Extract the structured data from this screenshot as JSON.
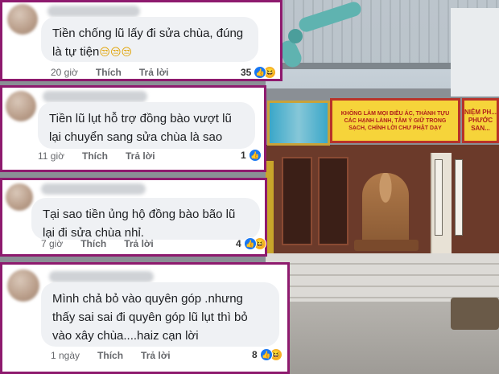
{
  "comments": [
    {
      "text": "Tiền chống lũ lấy đi sửa chùa, đúng là tự tiện",
      "emoji": "😒😒😒",
      "time": "20 giờ",
      "like": "Thích",
      "reply": "Trả lời",
      "reactions": "35"
    },
    {
      "text": "Tiền lũ lụt hỗ trợ đồng bào vượt lũ lại chuyển sang sửa chùa là sao",
      "time": "11 giờ",
      "like": "Thích",
      "reply": "Trả lời",
      "reactions": "1"
    },
    {
      "text": "Tại sao tiền ủng hộ đồng bào bão lũ lại đi sửa chùa nhỉ.",
      "time": "7 giờ",
      "like": "Thích",
      "reply": "Trả lời",
      "reactions": "4"
    },
    {
      "text": "Mình chả bỏ vào quyên góp .nhưng thấy sai sai đi quyên góp lũ lụt thì bỏ vào xây chùa....haiz cạn lời",
      "time": "1 ngày",
      "like": "Thích",
      "reply": "Trả lời",
      "reactions": "8"
    }
  ],
  "background": {
    "sign_main": "KHÔNG LÀM MỌI ĐIỀU ÁC, THÀNH TỰU CÁC HẠNH LÀNH, TÂM Ý GIỮ TRONG SẠCH, CHÍNH LỜI CHƯ PHẬT DẠY",
    "sign_side": "NIỆM PH... PHƯỚC SAN..."
  },
  "icons": {
    "like": "like-reaction-icon",
    "haha": "haha-reaction-icon"
  },
  "colors": {
    "card_border": "#8e1a6e",
    "bubble": "#eff1f4",
    "like_blue": "#1877f2",
    "haha_yellow": "#f7b125"
  }
}
